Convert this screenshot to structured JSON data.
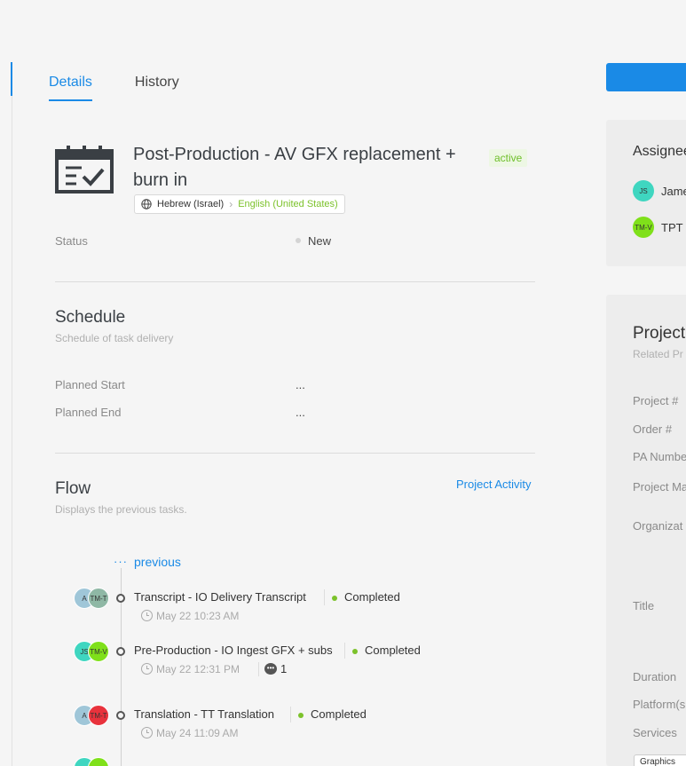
{
  "tabs": [
    {
      "label": "Details",
      "active": true
    },
    {
      "label": "History",
      "active": false
    }
  ],
  "task": {
    "title": "Post-Production - AV GFX replacement + burn in",
    "state_badge": "active",
    "source_language": "Hebrew (Israel)",
    "target_language": "English (United States)",
    "status_label": "Status",
    "status_value": "New"
  },
  "schedule": {
    "title": "Schedule",
    "subtitle": "Schedule of task delivery",
    "planned_start_label": "Planned Start",
    "planned_start_value": "...",
    "planned_end_label": "Planned End",
    "planned_end_value": "..."
  },
  "flow": {
    "title": "Flow",
    "subtitle": "Displays the previous tasks.",
    "project_activity_link": "Project Activity",
    "previous_dots": "···",
    "previous_link": "previous",
    "items": [
      {
        "avatars": [
          {
            "initials": "A",
            "color": "#9fc6d8"
          },
          {
            "initials": "TM-T",
            "color": "#8fb8a5"
          }
        ],
        "title": "Transcript - IO Delivery Transcript",
        "status": "Completed",
        "time": "May 22 10:23 AM",
        "comments": ""
      },
      {
        "avatars": [
          {
            "initials": "JS",
            "color": "#3fd6c0"
          },
          {
            "initials": "TM-V",
            "color": "#7fe01a"
          }
        ],
        "title": "Pre-Production - IO Ingest GFX + subs",
        "status": "Completed",
        "time": "May 22 12:31 PM",
        "comments": "1"
      },
      {
        "avatars": [
          {
            "initials": "A",
            "color": "#9fc6d8"
          },
          {
            "initials": "TM-T",
            "color": "#e8323c"
          }
        ],
        "title": "Translation - TT Translation",
        "status": "Completed",
        "time": "May 24 11:09 AM",
        "comments": ""
      }
    ]
  },
  "assignees": {
    "title": "Assignee",
    "items": [
      {
        "initials": "JS",
        "name": "Jame",
        "color": "#3fd6c0"
      },
      {
        "initials": "TM-V",
        "name": "TPT I",
        "color": "#7fe01a"
      }
    ]
  },
  "project": {
    "title": "Project",
    "subtitle": "Related Pr",
    "fields": [
      "Project #",
      "Order #",
      "PA Numbe",
      "Project Ma",
      "Organizat",
      "Title",
      "Duration",
      "Platform(s",
      "Services"
    ],
    "service_chip": "Graphics"
  },
  "colors": {
    "accent": "#1a8ae6",
    "completed": "#7cc22b",
    "active_badge_bg": "#edf7e4"
  }
}
